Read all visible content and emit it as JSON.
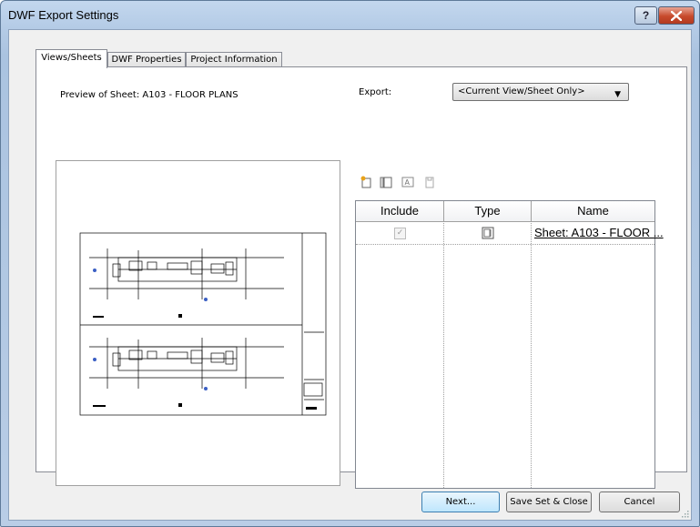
{
  "window": {
    "title": "DWF Export Settings"
  },
  "tabs": [
    {
      "label": "Views/Sheets"
    },
    {
      "label": "DWF Properties"
    },
    {
      "label": "Project Information"
    }
  ],
  "preview": {
    "label": "Preview of Sheet: A103 - FLOOR PLANS"
  },
  "export": {
    "label": "Export:",
    "value": "<Current View/Sheet Only>"
  },
  "table": {
    "columns": [
      "Include",
      "Type",
      "Name"
    ],
    "rows": [
      {
        "include": true,
        "type_icon": "sheet-icon",
        "name": "Sheet: A103 - FLOOR ..."
      }
    ]
  },
  "buttons": {
    "next": "Next...",
    "save_close": "Save Set & Close",
    "cancel": "Cancel"
  },
  "colors": {
    "title_bg": "#b4cbe6",
    "close_button": "#c74a2c",
    "default_button": "#bee6fd"
  }
}
